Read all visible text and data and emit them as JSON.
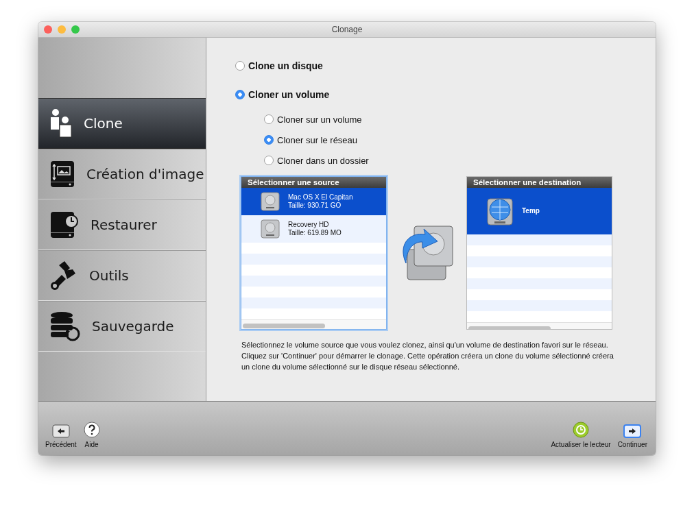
{
  "window": {
    "title": "Clonage"
  },
  "sidebar": {
    "items": [
      {
        "label": "Clone",
        "selected": true
      },
      {
        "label": "Création d'image",
        "selected": false
      },
      {
        "label": "Restaurer",
        "selected": false
      },
      {
        "label": "Outils",
        "selected": false
      },
      {
        "label": "Sauvegarde",
        "selected": false
      }
    ]
  },
  "options": [
    {
      "label": "Clone un disque",
      "selected": false
    },
    {
      "label": "Cloner un volume",
      "selected": true,
      "children": [
        {
          "label": "Cloner sur un volume",
          "selected": false
        },
        {
          "label": "Cloner sur le réseau",
          "selected": true
        },
        {
          "label": "Cloner dans un dossier",
          "selected": false
        }
      ]
    }
  ],
  "source": {
    "title": "Sélectionner une source",
    "focused": true,
    "rows": [
      {
        "name": "Mac OS X El Capitan",
        "size": "Taille: 930.71 GO",
        "selected": true
      },
      {
        "name": "Recovery HD",
        "size": "Taille: 619.89 MO",
        "selected": false
      }
    ]
  },
  "destination": {
    "title": "Sélectionner une destination",
    "focused": false,
    "rows": [
      {
        "name": "Temp",
        "selected": true
      }
    ]
  },
  "description": "Sélectionnez le volume source que vous voulez clonez, ainsi qu'un volume de destination favori sur le réseau. Cliquez sur 'Continuer' pour démarrer le clonage. Cette opération créera un clone du volume sélectionné créera un clone du volume sélectionné sur le disque réseau sélectionné.",
  "toolbar": {
    "left": [
      {
        "label": "Précédent"
      },
      {
        "label": "Aide"
      }
    ],
    "right": [
      {
        "label": "Actualiser le lecteur"
      },
      {
        "label": "Continuer"
      }
    ]
  }
}
